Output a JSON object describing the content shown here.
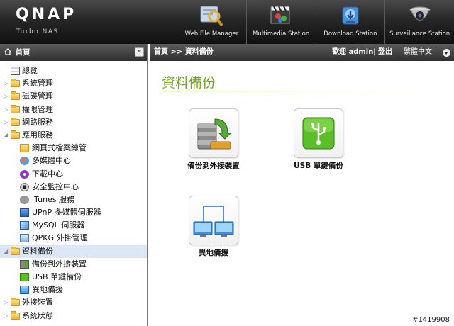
{
  "brand": {
    "logo": "QNAP",
    "subtitle": "Turbo NAS"
  },
  "apps": [
    {
      "label": "Web File Manager",
      "icon": "web-file-manager-icon"
    },
    {
      "label": "Multimedia Station",
      "icon": "multimedia-station-icon"
    },
    {
      "label": "Download Station",
      "icon": "download-station-icon"
    },
    {
      "label": "Surveillance Station",
      "icon": "surveillance-station-icon"
    }
  ],
  "left": {
    "title": "首頁",
    "collapse_label": "«",
    "tree": [
      {
        "label": "總覽",
        "icon": "overview-icon",
        "level": 0,
        "expand": ""
      },
      {
        "label": "系統管理",
        "icon": "folder-icon",
        "level": 0,
        "expand": "▷"
      },
      {
        "label": "磁碟管理",
        "icon": "folder-icon",
        "level": 0,
        "expand": "▷"
      },
      {
        "label": "權限管理",
        "icon": "folder-icon",
        "level": 0,
        "expand": "▷"
      },
      {
        "label": "網路服務",
        "icon": "folder-icon",
        "level": 0,
        "expand": "▷"
      },
      {
        "label": "應用服務",
        "icon": "folder-open-icon",
        "level": 0,
        "expand": "◢"
      },
      {
        "label": "網頁式檔案總管",
        "icon": "file-manager-folder-icon",
        "level": 1,
        "expand": ""
      },
      {
        "label": "多媒體中心",
        "icon": "multimedia-icon",
        "level": 1,
        "expand": ""
      },
      {
        "label": "下載中心",
        "icon": "download-icon",
        "level": 1,
        "expand": ""
      },
      {
        "label": "安全監控中心",
        "icon": "camera-icon",
        "level": 1,
        "expand": ""
      },
      {
        "label": "iTunes 服務",
        "icon": "itunes-icon",
        "level": 1,
        "expand": ""
      },
      {
        "label": "UPnP 多媒體伺服器",
        "icon": "upnp-icon",
        "level": 1,
        "expand": ""
      },
      {
        "label": "MySQL 伺服器",
        "icon": "mysql-icon",
        "level": 1,
        "expand": ""
      },
      {
        "label": "QPKG 外掛管理",
        "icon": "qpkg-icon",
        "level": 1,
        "expand": ""
      },
      {
        "label": "資料備份",
        "icon": "folder-open-icon",
        "level": 0,
        "expand": "◢",
        "selected": true
      },
      {
        "label": "備份到外接裝置",
        "icon": "backup-external-icon",
        "level": 1,
        "expand": ""
      },
      {
        "label": "USB 單鍵備份",
        "icon": "usb-icon",
        "level": 1,
        "expand": ""
      },
      {
        "label": "異地備援",
        "icon": "remote-replication-icon",
        "level": 1,
        "expand": ""
      },
      {
        "label": "外接裝置",
        "icon": "folder-icon",
        "level": 0,
        "expand": "▷"
      },
      {
        "label": "系統狀態",
        "icon": "folder-icon",
        "level": 0,
        "expand": "▷"
      }
    ]
  },
  "right": {
    "breadcrumb": "首頁 >> 資料備份",
    "welcome": "歡迎 admin",
    "divider": "|",
    "logout": "登出",
    "language": "繁體中文",
    "page_title": "資料備份",
    "tiles": [
      {
        "label": "備份到外接裝置",
        "icon": "backup-external-icon"
      },
      {
        "label": "USB 單鍵備份",
        "icon": "usb-backup-icon"
      },
      {
        "label": "異地備援",
        "icon": "remote-replication-icon"
      }
    ]
  },
  "watermark": "#1419908",
  "colors": {
    "title_green": "#73a224",
    "header_dark": "#2f2f2f",
    "selected_row": "#dce6f4"
  }
}
